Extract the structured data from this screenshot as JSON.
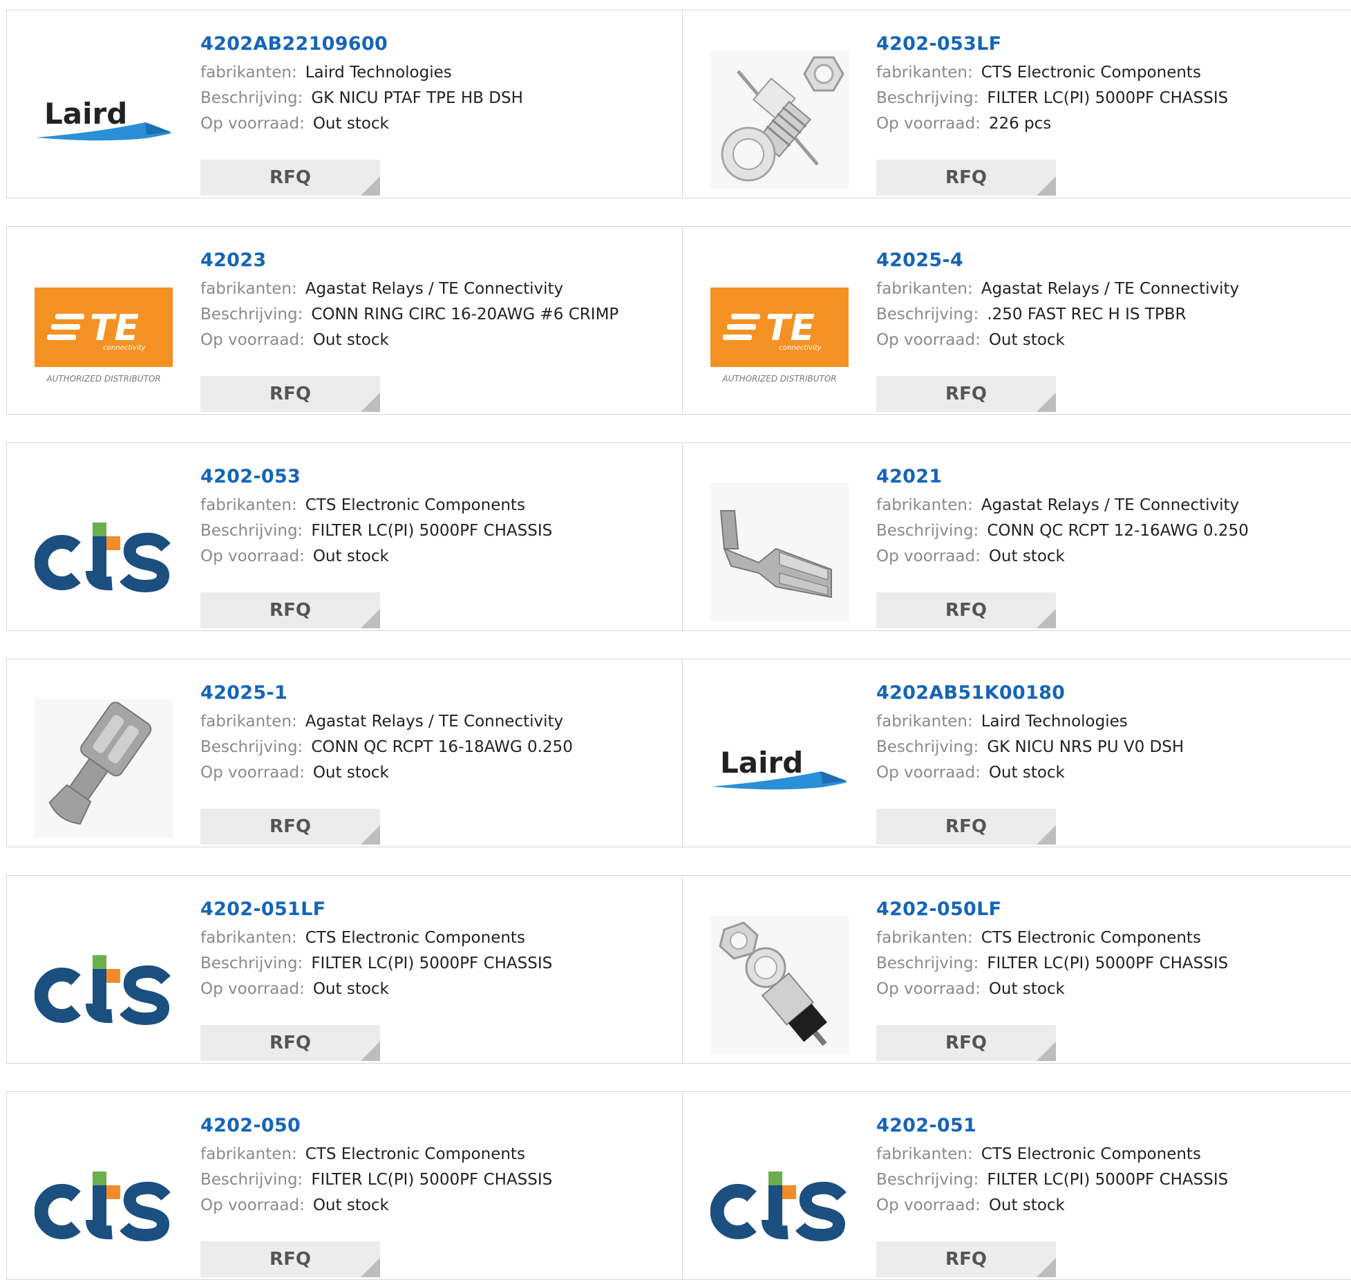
{
  "labels": {
    "manufacturer": "fabrikanten:",
    "description": "Beschrijving:",
    "stock": "Op voorraad:",
    "rfq": "RFQ"
  },
  "logo_text": {
    "laird": "Laird",
    "te": "TE",
    "te_sub": "connectivity",
    "te_auth": "AUTHORIZED DISTRIBUTOR",
    "cts": "CTS"
  },
  "colors": {
    "part_link": "#1565b8",
    "te_orange": "#f39223",
    "cts_navy": "#1b4f80",
    "cts_green": "#6ab04c",
    "cts_orange": "#f28c28",
    "laird_swoosh": "#2a8fd6"
  },
  "products": [
    {
      "part": "4202AB22109600",
      "manufacturer": "Laird Technologies",
      "description": "GK NICU PTAF TPE HB DSH",
      "stock": "Out stock",
      "image": "laird-logo"
    },
    {
      "part": "4202-053LF",
      "manufacturer": "CTS Electronic Components",
      "description": "FILTER LC(PI) 5000PF CHASSIS",
      "stock": "226 pcs",
      "image": "filter-with-nut-photo"
    },
    {
      "part": "42023",
      "manufacturer": "Agastat Relays / TE Connectivity",
      "description": "CONN RING CIRC 16-20AWG #6 CRIMP",
      "stock": "Out stock",
      "image": "te-logo"
    },
    {
      "part": "42025-4",
      "manufacturer": "Agastat Relays / TE Connectivity",
      "description": ".250 FAST REC H IS TPBR",
      "stock": "Out stock",
      "image": "te-logo"
    },
    {
      "part": "4202-053",
      "manufacturer": "CTS Electronic Components",
      "description": "FILTER LC(PI) 5000PF CHASSIS",
      "stock": "Out stock",
      "image": "cts-logo"
    },
    {
      "part": "42021",
      "manufacturer": "Agastat Relays / TE Connectivity",
      "description": "CONN QC RCPT 12-16AWG 0.250",
      "stock": "Out stock",
      "image": "quick-connect-photo"
    },
    {
      "part": "42025-1",
      "manufacturer": "Agastat Relays / TE Connectivity",
      "description": "CONN QC RCPT 16-18AWG 0.250",
      "stock": "Out stock",
      "image": "receptacle-photo"
    },
    {
      "part": "4202AB51K00180",
      "manufacturer": "Laird Technologies",
      "description": "GK NICU NRS PU V0 DSH",
      "stock": "Out stock",
      "image": "laird-logo"
    },
    {
      "part": "4202-051LF",
      "manufacturer": "CTS Electronic Components",
      "description": "FILTER LC(PI) 5000PF CHASSIS",
      "stock": "Out stock",
      "image": "cts-logo"
    },
    {
      "part": "4202-050LF",
      "manufacturer": "CTS Electronic Components",
      "description": "FILTER LC(PI) 5000PF CHASSIS",
      "stock": "Out stock",
      "image": "filter-with-washer-photo"
    },
    {
      "part": "4202-050",
      "manufacturer": "CTS Electronic Components",
      "description": "FILTER LC(PI) 5000PF CHASSIS",
      "stock": "Out stock",
      "image": "cts-logo"
    },
    {
      "part": "4202-051",
      "manufacturer": "CTS Electronic Components",
      "description": "FILTER LC(PI) 5000PF CHASSIS",
      "stock": "Out stock",
      "image": "cts-logo"
    }
  ]
}
